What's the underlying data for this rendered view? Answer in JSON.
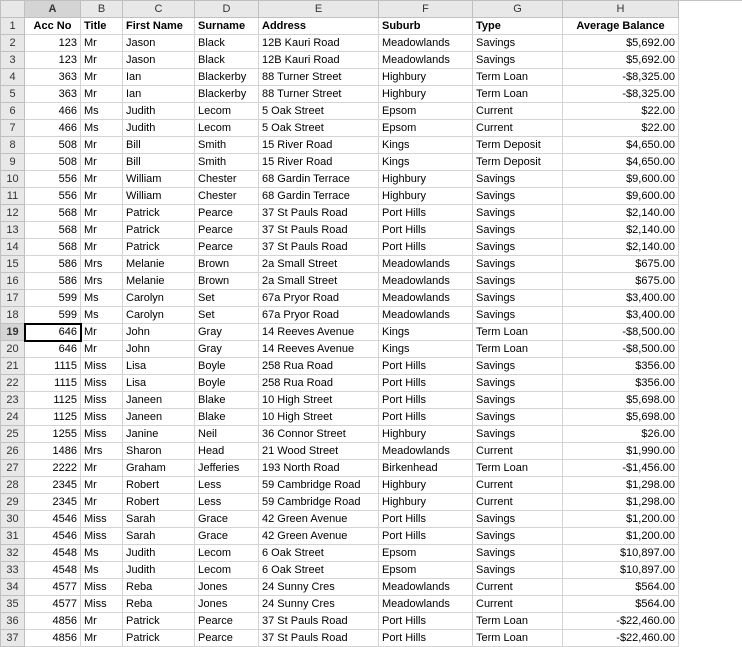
{
  "columns": [
    "A",
    "B",
    "C",
    "D",
    "E",
    "F",
    "G",
    "H"
  ],
  "selected_col": "A",
  "selected_row": 19,
  "headers": {
    "A": "Acc No",
    "B": "Title",
    "C": "First Name",
    "D": "Surname",
    "E": "Address",
    "F": "Suburb",
    "G": "Type",
    "H": "Average Balance"
  },
  "rows": [
    {
      "n": 2,
      "A": "123",
      "B": "Mr",
      "C": "Jason",
      "D": "Black",
      "E": "12B Kauri Road",
      "F": "Meadowlands",
      "G": "Savings",
      "H": "$5,692.00"
    },
    {
      "n": 3,
      "A": "123",
      "B": "Mr",
      "C": "Jason",
      "D": "Black",
      "E": "12B Kauri Road",
      "F": "Meadowlands",
      "G": "Savings",
      "H": "$5,692.00"
    },
    {
      "n": 4,
      "A": "363",
      "B": "Mr",
      "C": "Ian",
      "D": "Blackerby",
      "E": "88 Turner Street",
      "F": "Highbury",
      "G": "Term Loan",
      "H": "-$8,325.00"
    },
    {
      "n": 5,
      "A": "363",
      "B": "Mr",
      "C": "Ian",
      "D": "Blackerby",
      "E": "88 Turner Street",
      "F": "Highbury",
      "G": "Term Loan",
      "H": "-$8,325.00"
    },
    {
      "n": 6,
      "A": "466",
      "B": "Ms",
      "C": "Judith",
      "D": "Lecom",
      "E": "5 Oak Street",
      "F": "Epsom",
      "G": "Current",
      "H": "$22.00"
    },
    {
      "n": 7,
      "A": "466",
      "B": "Ms",
      "C": "Judith",
      "D": "Lecom",
      "E": "5 Oak Street",
      "F": "Epsom",
      "G": "Current",
      "H": "$22.00"
    },
    {
      "n": 8,
      "A": "508",
      "B": "Mr",
      "C": "Bill",
      "D": "Smith",
      "E": "15 River Road",
      "F": "Kings",
      "G": "Term Deposit",
      "H": "$4,650.00"
    },
    {
      "n": 9,
      "A": "508",
      "B": "Mr",
      "C": "Bill",
      "D": "Smith",
      "E": "15 River Road",
      "F": "Kings",
      "G": "Term Deposit",
      "H": "$4,650.00"
    },
    {
      "n": 10,
      "A": "556",
      "B": "Mr",
      "C": "William",
      "D": "Chester",
      "E": "68 Gardin Terrace",
      "F": "Highbury",
      "G": "Savings",
      "H": "$9,600.00"
    },
    {
      "n": 11,
      "A": "556",
      "B": "Mr",
      "C": "William",
      "D": "Chester",
      "E": "68 Gardin Terrace",
      "F": "Highbury",
      "G": "Savings",
      "H": "$9,600.00"
    },
    {
      "n": 12,
      "A": "568",
      "B": "Mr",
      "C": "Patrick",
      "D": "Pearce",
      "E": "37 St Pauls Road",
      "F": "Port Hills",
      "G": "Savings",
      "H": "$2,140.00"
    },
    {
      "n": 13,
      "A": "568",
      "B": "Mr",
      "C": "Patrick",
      "D": "Pearce",
      "E": "37 St Pauls Road",
      "F": "Port Hills",
      "G": "Savings",
      "H": "$2,140.00"
    },
    {
      "n": 14,
      "A": "568",
      "B": "Mr",
      "C": "Patrick",
      "D": "Pearce",
      "E": "37 St Pauls Road",
      "F": "Port Hills",
      "G": "Savings",
      "H": "$2,140.00"
    },
    {
      "n": 15,
      "A": "586",
      "B": "Mrs",
      "C": "Melanie",
      "D": "Brown",
      "E": "2a Small Street",
      "F": "Meadowlands",
      "G": "Savings",
      "H": "$675.00"
    },
    {
      "n": 16,
      "A": "586",
      "B": "Mrs",
      "C": "Melanie",
      "D": "Brown",
      "E": "2a Small Street",
      "F": "Meadowlands",
      "G": "Savings",
      "H": "$675.00"
    },
    {
      "n": 17,
      "A": "599",
      "B": "Ms",
      "C": "Carolyn",
      "D": "Set",
      "E": "67a Pryor Road",
      "F": "Meadowlands",
      "G": "Savings",
      "H": "$3,400.00"
    },
    {
      "n": 18,
      "A": "599",
      "B": "Ms",
      "C": "Carolyn",
      "D": "Set",
      "E": "67a Pryor Road",
      "F": "Meadowlands",
      "G": "Savings",
      "H": "$3,400.00"
    },
    {
      "n": 19,
      "A": "646",
      "B": "Mr",
      "C": "John",
      "D": "Gray",
      "E": "14 Reeves Avenue",
      "F": "Kings",
      "G": "Term Loan",
      "H": "-$8,500.00"
    },
    {
      "n": 20,
      "A": "646",
      "B": "Mr",
      "C": "John",
      "D": "Gray",
      "E": "14 Reeves Avenue",
      "F": "Kings",
      "G": "Term Loan",
      "H": "-$8,500.00"
    },
    {
      "n": 21,
      "A": "1115",
      "B": "Miss",
      "C": "Lisa",
      "D": "Boyle",
      "E": "258 Rua Road",
      "F": "Port Hills",
      "G": "Savings",
      "H": "$356.00"
    },
    {
      "n": 22,
      "A": "1115",
      "B": "Miss",
      "C": "Lisa",
      "D": "Boyle",
      "E": "258 Rua Road",
      "F": "Port Hills",
      "G": "Savings",
      "H": "$356.00"
    },
    {
      "n": 23,
      "A": "1125",
      "B": "Miss",
      "C": "Janeen",
      "D": "Blake",
      "E": "10 High Street",
      "F": "Port Hills",
      "G": "Savings",
      "H": "$5,698.00"
    },
    {
      "n": 24,
      "A": "1125",
      "B": "Miss",
      "C": "Janeen",
      "D": "Blake",
      "E": "10 High Street",
      "F": "Port Hills",
      "G": "Savings",
      "H": "$5,698.00"
    },
    {
      "n": 25,
      "A": "1255",
      "B": "Miss",
      "C": "Janine",
      "D": "Neil",
      "E": "36 Connor Street",
      "F": "Highbury",
      "G": "Savings",
      "H": "$26.00"
    },
    {
      "n": 26,
      "A": "1486",
      "B": "Mrs",
      "C": "Sharon",
      "D": "Head",
      "E": "21 Wood Street",
      "F": "Meadowlands",
      "G": "Current",
      "H": "$1,990.00"
    },
    {
      "n": 27,
      "A": "2222",
      "B": "Mr",
      "C": "Graham",
      "D": "Jefferies",
      "E": "193 North Road",
      "F": "Birkenhead",
      "G": "Term Loan",
      "H": "-$1,456.00"
    },
    {
      "n": 28,
      "A": "2345",
      "B": "Mr",
      "C": "Robert",
      "D": "Less",
      "E": "59 Cambridge Road",
      "F": "Highbury",
      "G": "Current",
      "H": "$1,298.00"
    },
    {
      "n": 29,
      "A": "2345",
      "B": "Mr",
      "C": "Robert",
      "D": "Less",
      "E": "59 Cambridge Road",
      "F": "Highbury",
      "G": "Current",
      "H": "$1,298.00"
    },
    {
      "n": 30,
      "A": "4546",
      "B": "Miss",
      "C": "Sarah",
      "D": "Grace",
      "E": "42 Green Avenue",
      "F": "Port Hills",
      "G": "Savings",
      "H": "$1,200.00"
    },
    {
      "n": 31,
      "A": "4546",
      "B": "Miss",
      "C": "Sarah",
      "D": "Grace",
      "E": "42 Green Avenue",
      "F": "Port Hills",
      "G": "Savings",
      "H": "$1,200.00"
    },
    {
      "n": 32,
      "A": "4548",
      "B": "Ms",
      "C": "Judith",
      "D": "Lecom",
      "E": "6 Oak Street",
      "F": "Epsom",
      "G": "Savings",
      "H": "$10,897.00"
    },
    {
      "n": 33,
      "A": "4548",
      "B": "Ms",
      "C": "Judith",
      "D": "Lecom",
      "E": "6 Oak Street",
      "F": "Epsom",
      "G": "Savings",
      "H": "$10,897.00"
    },
    {
      "n": 34,
      "A": "4577",
      "B": "Miss",
      "C": "Reba",
      "D": "Jones",
      "E": "24 Sunny Cres",
      "F": "Meadowlands",
      "G": "Current",
      "H": "$564.00"
    },
    {
      "n": 35,
      "A": "4577",
      "B": "Miss",
      "C": "Reba",
      "D": "Jones",
      "E": "24 Sunny Cres",
      "F": "Meadowlands",
      "G": "Current",
      "H": "$564.00"
    },
    {
      "n": 36,
      "A": "4856",
      "B": "Mr",
      "C": "Patrick",
      "D": "Pearce",
      "E": "37 St Pauls Road",
      "F": "Port Hills",
      "G": "Term Loan",
      "H": "-$22,460.00"
    },
    {
      "n": 37,
      "A": "4856",
      "B": "Mr",
      "C": "Patrick",
      "D": "Pearce",
      "E": "37 St Pauls Road",
      "F": "Port Hills",
      "G": "Term Loan",
      "H": "-$22,460.00"
    }
  ]
}
